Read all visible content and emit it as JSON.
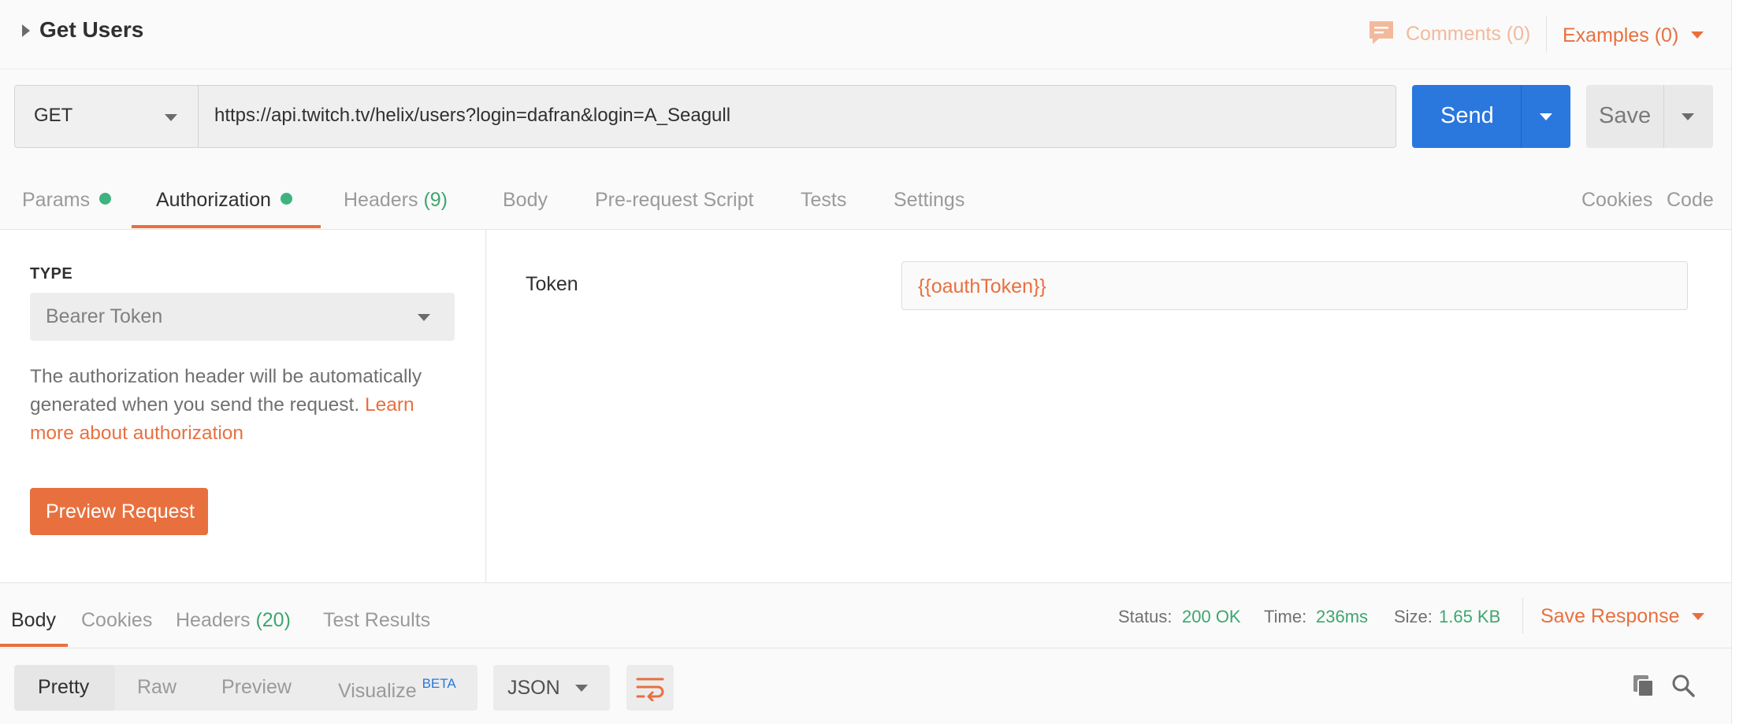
{
  "request": {
    "name": "Get Users",
    "comments_label": "Comments (0)",
    "examples_label": "Examples (0)",
    "method": "GET",
    "url": "https://api.twitch.tv/helix/users?login=dafran&login=A_Seagull",
    "send_label": "Send",
    "save_label": "Save"
  },
  "tabs": {
    "params": "Params",
    "authorization": "Authorization",
    "headers": "Headers",
    "headers_count": "(9)",
    "body": "Body",
    "prerequest": "Pre-request Script",
    "tests": "Tests",
    "settings": "Settings",
    "cookies": "Cookies",
    "code": "Code"
  },
  "auth": {
    "type_label": "TYPE",
    "type_value": "Bearer Token",
    "description": "The authorization header will be automatically generated when you send the request. ",
    "learn_more": "Learn more about authorization",
    "preview_button": "Preview Request",
    "token_label": "Token",
    "token_value": "{{oauthToken}}"
  },
  "response": {
    "tabs": {
      "body": "Body",
      "cookies": "Cookies",
      "headers": "Headers",
      "headers_count": "(20)",
      "test_results": "Test Results"
    },
    "status_label": "Status:",
    "status_value": "200 OK",
    "time_label": "Time:",
    "time_value": "236ms",
    "size_label": "Size:",
    "size_value": "1.65 KB",
    "save_response": "Save Response",
    "formats": {
      "pretty": "Pretty",
      "raw": "Raw",
      "preview": "Preview",
      "visualize": "Visualize",
      "beta": "BETA"
    },
    "language": "JSON"
  },
  "colors": {
    "accent": "#e8703f",
    "send": "#2a77de",
    "success": "#3fa66f"
  }
}
